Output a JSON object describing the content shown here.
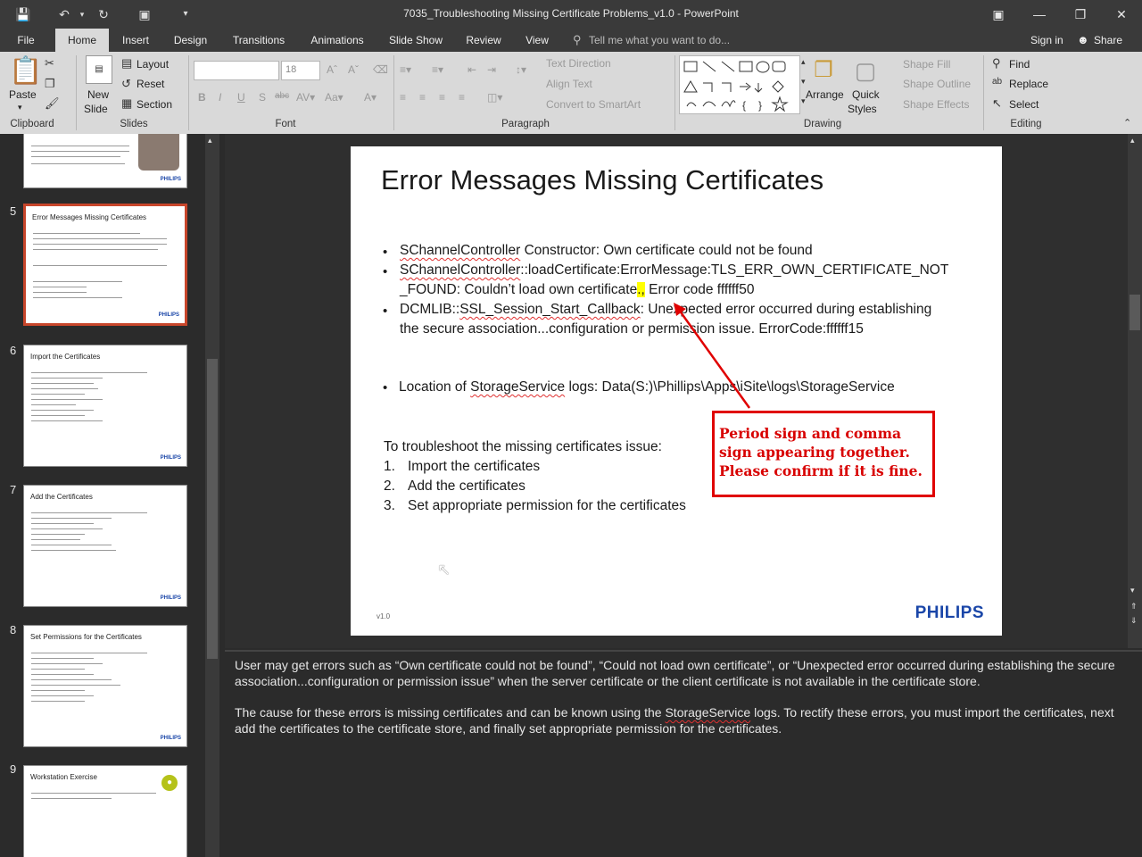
{
  "window": {
    "title": "7035_Troubleshooting Missing Certificate Problems_v1.0 - PowerPoint"
  },
  "tabs": [
    "File",
    "Home",
    "Insert",
    "Design",
    "Transitions",
    "Animations",
    "Slide Show",
    "Review",
    "View"
  ],
  "active_tab": "Home",
  "tell_me": "Tell me what you want to do...",
  "sign_in": "Sign in",
  "share": "Share",
  "ribbon": {
    "clipboard": {
      "label": "Clipboard",
      "paste": "Paste"
    },
    "slides": {
      "label": "Slides",
      "new_slide": "New",
      "new_slide_2": "Slide",
      "layout": "Layout",
      "reset": "Reset",
      "section": "Section"
    },
    "font": {
      "label": "Font",
      "size": "18"
    },
    "paragraph": {
      "label": "Paragraph",
      "text_direction": "Text Direction",
      "align_text": "Align Text",
      "convert": "Convert to SmartArt"
    },
    "drawing": {
      "label": "Drawing",
      "arrange": "Arrange",
      "quick_styles": "Quick",
      "quick_styles_2": "Styles",
      "shape_fill": "Shape Fill",
      "shape_outline": "Shape Outline",
      "shape_effects": "Shape Effects"
    },
    "editing": {
      "label": "Editing",
      "find": "Find",
      "replace": "Replace",
      "select": "Select"
    }
  },
  "thumbnails": [
    {
      "num": "5",
      "title": "Error Messages Missing Certificates"
    },
    {
      "num": "6",
      "title": "Import the Certificates"
    },
    {
      "num": "7",
      "title": "Add the Certificates"
    },
    {
      "num": "8",
      "title": "Set Permissions for the Certificates"
    },
    {
      "num": "9",
      "title": "Workstation Exercise"
    }
  ],
  "slide": {
    "title": "Error Messages Missing Certificates",
    "b1_a": "SChannelController",
    "b1_b": " Constructor: Own certificate could not be found",
    "b2_a": "SChannelController",
    "b2_b": "::loadCertificate:ErrorMessage:TLS_ERR_OWN_CERTIFICATE_NOT",
    "b2_c": "_FOUND: Couldn’t load own certificate",
    "b2_hl": ".,",
    "b2_d": " Error code ffffff50",
    "b3_a": "DCMLIB::",
    "b3_b": "SSL_Session_Start_Callback",
    "b3_c": ": Unexpected error occurred during establishing",
    "b3_d": "the secure association...configuration or permission issue. ErrorCode:ffffff15",
    "b4_a": "Location of ",
    "b4_b": "StorageService",
    "b4_c": " logs: Data(S:)\\Phillips\\Apps\\iSite\\logs\\StorageService",
    "intro": "To troubleshoot the missing certificates issue:",
    "steps": [
      "Import the certificates",
      "Add the certificates",
      "Set appropriate permission for the certificates"
    ],
    "step_nums": [
      "1.",
      "2.",
      "3."
    ],
    "version": "v1.0",
    "logo": "PHILIPS",
    "callout": "Period sign and comma sign appearing together. Please confirm if it is fine."
  },
  "notes": {
    "p1": "User may get errors such as “Own certificate could not be found”, “Could not load own certificate”, or “Unexpected error occurred during establishing the secure association...configuration or permission issue” when the server certificate or the client certificate is not available in the certificate store.",
    "p2_a": "The cause for these errors is missing certificates and can be known using the ",
    "p2_b": "StorageService",
    "p2_c": " logs. To rectify these errors, you must import the certificates, next add the certificates to the certificate store, and finally set appropriate permission for the certificates."
  },
  "colors": {
    "accent": "#c8462b",
    "callout": "#e00000",
    "brand": "#1a46a8",
    "highlight": "#ffff00"
  }
}
